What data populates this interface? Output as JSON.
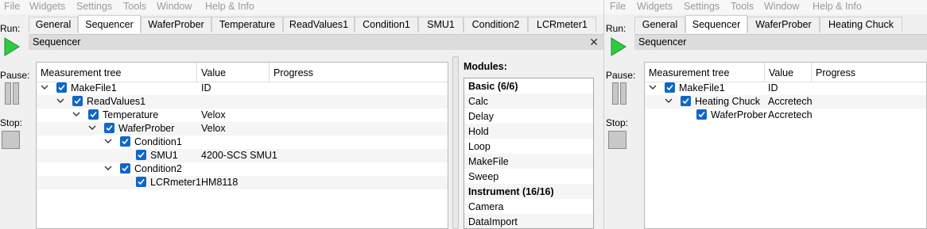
{
  "left": {
    "menu": [
      "File",
      "Widgets",
      "Settings",
      "Tools",
      "Window",
      "Help & Info"
    ],
    "controls": {
      "run": "Run:",
      "pause": "Pause:",
      "stop": "Stop:"
    },
    "tabs": [
      "General",
      "Sequencer",
      "WaferProber",
      "Temperature",
      "ReadValues1",
      "Condition1",
      "SMU1",
      "Condition2",
      "LCRmeter1"
    ],
    "active_tab": "Sequencer",
    "pane_title": "Sequencer",
    "columns": [
      "Measurement tree",
      "Value",
      "Progress"
    ],
    "tree": [
      {
        "label": "MakeFile1",
        "value": "ID"
      },
      {
        "label": "ReadValues1",
        "value": ""
      },
      {
        "label": "Temperature",
        "value": "Velox"
      },
      {
        "label": "WaferProber",
        "value": "Velox"
      },
      {
        "label": "Condition1",
        "value": ""
      },
      {
        "label": "SMU1",
        "value": "4200-SCS SMU1"
      },
      {
        "label": "Condition2",
        "value": ""
      },
      {
        "label": "LCRmeter1",
        "value": "HM8118"
      }
    ],
    "modules_title": "Modules:",
    "modules": [
      {
        "label": "Basic (6/6)",
        "header": true
      },
      {
        "label": "Calc"
      },
      {
        "label": "Delay"
      },
      {
        "label": "Hold"
      },
      {
        "label": "Loop"
      },
      {
        "label": "MakeFile"
      },
      {
        "label": "Sweep"
      },
      {
        "label": "Instrument (16/16)",
        "header": true
      },
      {
        "label": "Camera"
      },
      {
        "label": "DataImport"
      }
    ]
  },
  "right": {
    "menu": [
      "File",
      "Widgets",
      "Settings",
      "Tools",
      "Window",
      "Help & Info"
    ],
    "controls": {
      "run": "Run:",
      "pause": "Pause:",
      "stop": "Stop:"
    },
    "tabs": [
      "General",
      "Sequencer",
      "WaferProber",
      "Heating Chuck"
    ],
    "active_tab": "Sequencer",
    "pane_title": "Sequencer",
    "columns": [
      "Measurement tree",
      "Value",
      "Progress"
    ],
    "tree": [
      {
        "label": "MakeFile1",
        "value": "ID"
      },
      {
        "label": "Heating Chuck",
        "value": "Accretech"
      },
      {
        "label": "WaferProber",
        "value": "Accretech"
      }
    ]
  },
  "colors": {
    "accent_checkbox": "#0f66c8",
    "run_green": "#2ecc40"
  }
}
